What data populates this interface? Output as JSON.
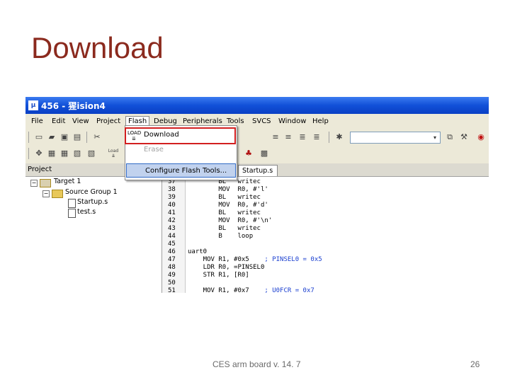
{
  "slide": {
    "title": "Download",
    "footer_text": "CES arm board v. 14. 7",
    "page_number": "26"
  },
  "window": {
    "app_icon": "μ",
    "title": "456 - 猩ision4"
  },
  "menu": {
    "items": [
      "File",
      "Edit",
      "View",
      "Project",
      "Flash",
      "Debug",
      "Peripherals",
      "Tools",
      "SVCS",
      "Window",
      "Help"
    ],
    "active": "Flash"
  },
  "flash_menu": {
    "download_icon_label": "LOAD",
    "items": [
      {
        "label": "Download",
        "enabled": true
      },
      {
        "label": "Erase",
        "enabled": false
      },
      {
        "label": "Configure Flash Tools...",
        "enabled": true
      }
    ]
  },
  "toolbar2": {
    "load_label": "Load"
  },
  "project_panel": {
    "title": "Project",
    "tree": {
      "target": "Target 1",
      "group": "Source Group 1",
      "files": [
        "Startup.s",
        "test.s"
      ]
    }
  },
  "editor": {
    "tab_label": "Startup.s",
    "lines": [
      {
        "num": "37",
        "code": "        BL   writec"
      },
      {
        "num": "38",
        "code": "        MOV  R0, #'l'"
      },
      {
        "num": "39",
        "code": "        BL   writec"
      },
      {
        "num": "40",
        "code": "        MOV  R0, #'d'"
      },
      {
        "num": "41",
        "code": "        BL   writec"
      },
      {
        "num": "42",
        "code": "        MOV  R0, #'\\n'"
      },
      {
        "num": "43",
        "code": "        BL   writec"
      },
      {
        "num": "44",
        "code": "        B    loop"
      },
      {
        "num": "45",
        "code": ""
      },
      {
        "num": "46",
        "code": "uart0"
      },
      {
        "num": "47",
        "code": "    MOV R1, #0x5    ; PINSEL0 = 0x5"
      },
      {
        "num": "48",
        "code": "    LDR R0, =PINSEL0"
      },
      {
        "num": "49",
        "code": "    STR R1, [R0]"
      },
      {
        "num": "50",
        "code": ""
      },
      {
        "num": "51",
        "code": "    MOV R1, #0x7    ; U0FCR = 0x7"
      }
    ]
  },
  "colors": {
    "title": "#8b2a1e",
    "highlight_box": "#d21f1f",
    "comment": "#1a3fd0"
  }
}
